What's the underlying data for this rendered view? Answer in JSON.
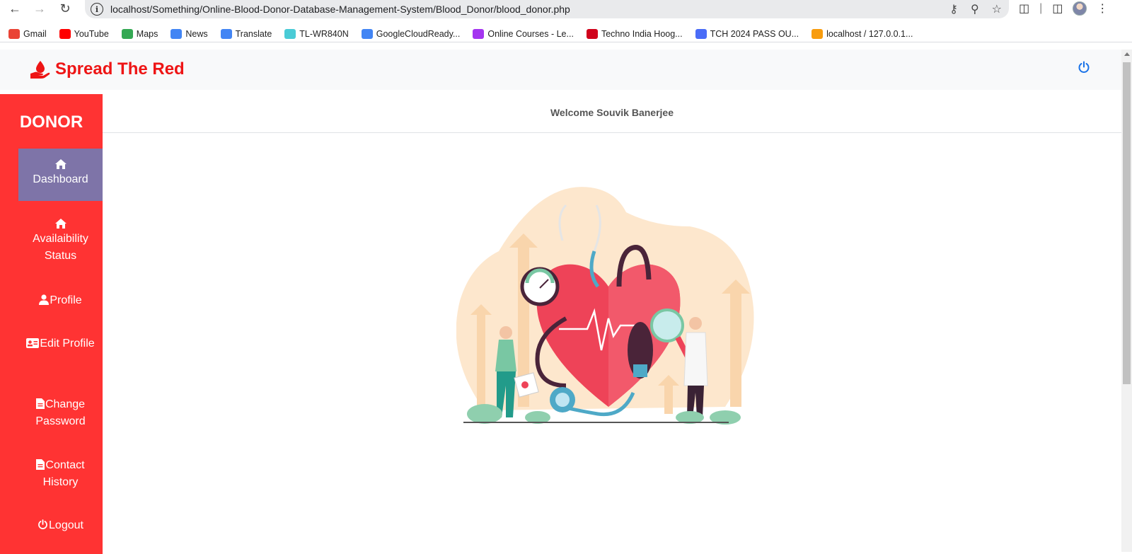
{
  "browser": {
    "url_host": "localhost",
    "url_path": "/Something/Online-Blood-Donor-Database-Management-System/Blood_Donor/blood_donor.php",
    "bookmarks": [
      {
        "label": "Gmail",
        "icon": "gmail-icon",
        "color": "#ea4335"
      },
      {
        "label": "YouTube",
        "icon": "youtube-icon",
        "color": "#ff0000"
      },
      {
        "label": "Maps",
        "icon": "maps-icon",
        "color": "#34a853"
      },
      {
        "label": "News",
        "icon": "news-icon",
        "color": "#4285f4"
      },
      {
        "label": "Translate",
        "icon": "translate-icon",
        "color": "#4285f4"
      },
      {
        "label": "TL-WR840N",
        "icon": "tplink-icon",
        "color": "#4acbd6"
      },
      {
        "label": "GoogleCloudReady...",
        "icon": "google-icon",
        "color": "#4285f4"
      },
      {
        "label": "Online Courses - Le...",
        "icon": "courses-icon",
        "color": "#a435f0"
      },
      {
        "label": "Techno India Hoog...",
        "icon": "techno-icon",
        "color": "#d0021b"
      },
      {
        "label": "TCH 2024 PASS OU...",
        "icon": "group-icon",
        "color": "#4a6cf7"
      },
      {
        "label": "localhost / 127.0.0.1...",
        "icon": "pma-icon",
        "color": "#f89c0e"
      }
    ]
  },
  "header": {
    "brand": "Spread The Red",
    "brand_color": "#ee1515"
  },
  "sidebar": {
    "title": "DONOR",
    "bg_color": "#ff3333",
    "active_color": "#7e74a8",
    "items": [
      {
        "label": "Dashboard",
        "icon": "home-icon"
      },
      {
        "label": "Availaibility Status",
        "icon": "home-icon"
      },
      {
        "label": "Profile",
        "icon": "user-icon"
      },
      {
        "label": "Edit Profile",
        "icon": "id-card-icon"
      },
      {
        "label": "Change Password",
        "icon": "file-icon"
      },
      {
        "label": "Contact History",
        "icon": "file-icon"
      },
      {
        "label": "Logout",
        "icon": "power-icon"
      }
    ]
  },
  "main": {
    "welcome": "Welcome Souvik Banerjee"
  }
}
